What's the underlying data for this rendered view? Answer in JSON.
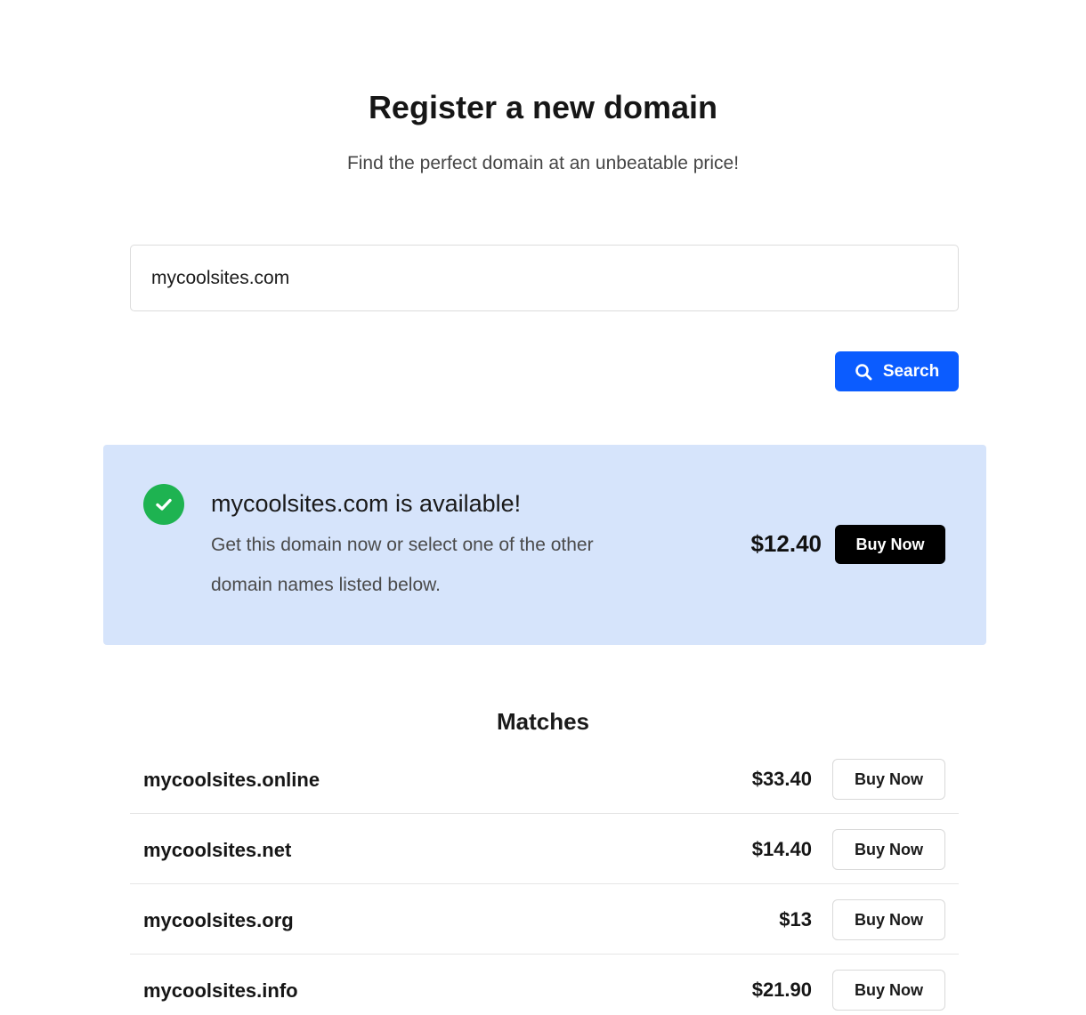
{
  "header": {
    "title": "Register a new domain",
    "subtitle": "Find the perfect domain at an unbeatable price!"
  },
  "search": {
    "value": "mycoolsites.com",
    "button_label": "Search",
    "button_icon": "search-icon"
  },
  "availability": {
    "icon": "check-circle-icon",
    "domain": "mycoolsites.com",
    "status_text": " is available!",
    "description": "Get this domain now or select one of the other domain names listed below.",
    "price": "$12.40",
    "buy_label": "Buy Now"
  },
  "matches": {
    "heading": "Matches",
    "items": [
      {
        "domain": "mycoolsites.online",
        "price": "$33.40",
        "buy_label": "Buy Now"
      },
      {
        "domain": "mycoolsites.net",
        "price": "$14.40",
        "buy_label": "Buy Now"
      },
      {
        "domain": "mycoolsites.org",
        "price": "$13",
        "buy_label": "Buy Now"
      },
      {
        "domain": "mycoolsites.info",
        "price": "$21.90",
        "buy_label": "Buy Now"
      }
    ]
  },
  "colors": {
    "primary_button": "#0b5cff",
    "available_bg": "#d6e4fb",
    "success_check": "#1eb351"
  }
}
